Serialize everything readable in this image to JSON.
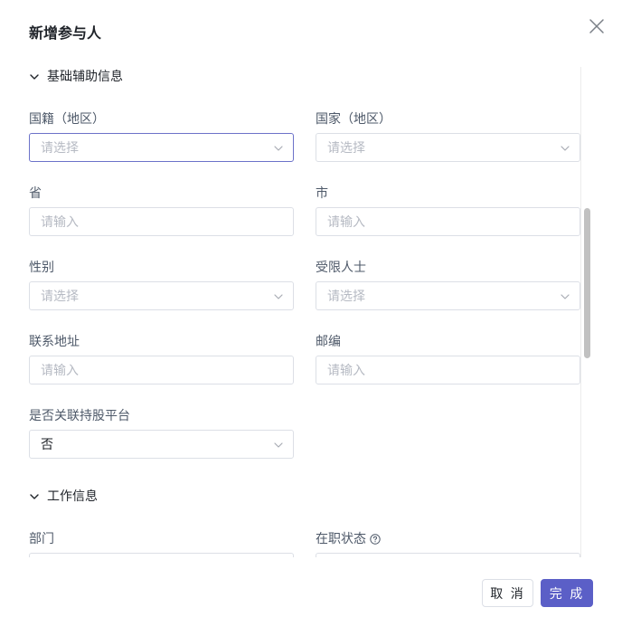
{
  "dialog": {
    "title": "新增参与人"
  },
  "sections": {
    "basic": {
      "label": "基础辅助信息"
    },
    "work": {
      "label": "工作信息"
    }
  },
  "fields": {
    "nationality": {
      "label": "国籍（地区）",
      "placeholder": "请选择"
    },
    "country": {
      "label": "国家（地区）",
      "placeholder": "请选择"
    },
    "province": {
      "label": "省",
      "placeholder": "请输入"
    },
    "city": {
      "label": "市",
      "placeholder": "请输入"
    },
    "gender": {
      "label": "性别",
      "placeholder": "请选择"
    },
    "restricted": {
      "label": "受限人士",
      "placeholder": "请选择"
    },
    "address": {
      "label": "联系地址",
      "placeholder": "请输入"
    },
    "postcode": {
      "label": "邮编",
      "placeholder": "请输入"
    },
    "platform": {
      "label": "是否关联持股平台",
      "value": "否"
    },
    "department": {
      "label": "部门"
    },
    "employment_status": {
      "label": "在职状态"
    }
  },
  "footer": {
    "cancel_label": "取 消",
    "done_label": "完 成"
  },
  "colors": {
    "accent": "#5b5fc7",
    "border": "#dcdfe6",
    "placeholder": "#b6bac3"
  }
}
